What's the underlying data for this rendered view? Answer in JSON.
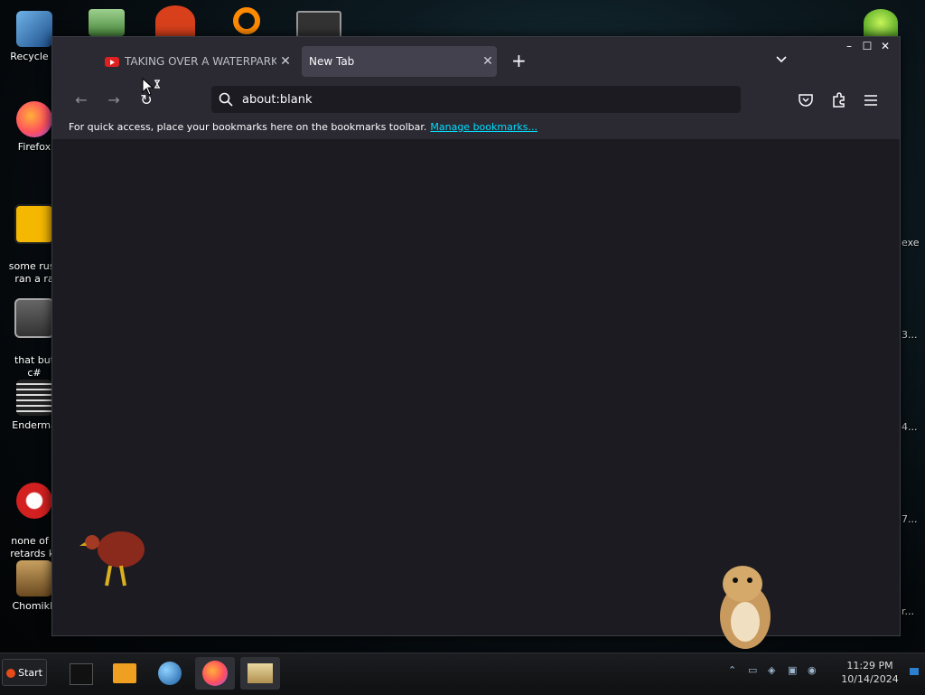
{
  "desktop": {
    "left_icons": [
      {
        "label": "Recycle B",
        "icon": "recycle-bin-icon"
      },
      {
        "label": "Firefox",
        "icon": "firefox-icon"
      },
      {
        "label": "some russ\nran a ra",
        "icon": "de-app-icon"
      },
      {
        "label": "that but\nc#",
        "icon": "copies-icon"
      },
      {
        "label": "Enderma",
        "icon": "endermanch-icon"
      },
      {
        "label": "none of y\nretards kr",
        "icon": "dino-icon"
      },
      {
        "label": "ChomikB",
        "icon": "hamster-box-icon"
      }
    ],
    "right_labels": [
      "exe",
      "3...",
      "4...",
      "7...",
      "r..."
    ]
  },
  "browser": {
    "tabs": [
      {
        "title": "TAKING OVER A WATERPARK",
        "icon": "youtube-icon",
        "active": false
      },
      {
        "title": "New Tab",
        "active": true
      }
    ],
    "new_tab_label": "+",
    "address": {
      "value": "about:blank"
    },
    "bookmarks_message": "For quick access, place your bookmarks here on the bookmarks toolbar.",
    "bookmarks_link": "Manage bookmarks...",
    "colors": {
      "chrome": "#2b2a33",
      "content": "#1c1b22",
      "link": "#00ddff"
    }
  },
  "taskbar": {
    "start_label": "Start",
    "apps": [
      "cmd-icon",
      "media-icon",
      "network-globe-icon",
      "firefox-icon",
      "explorer-icon"
    ],
    "clock": {
      "time": "11:29 PM",
      "date": "10/14/2024"
    }
  }
}
